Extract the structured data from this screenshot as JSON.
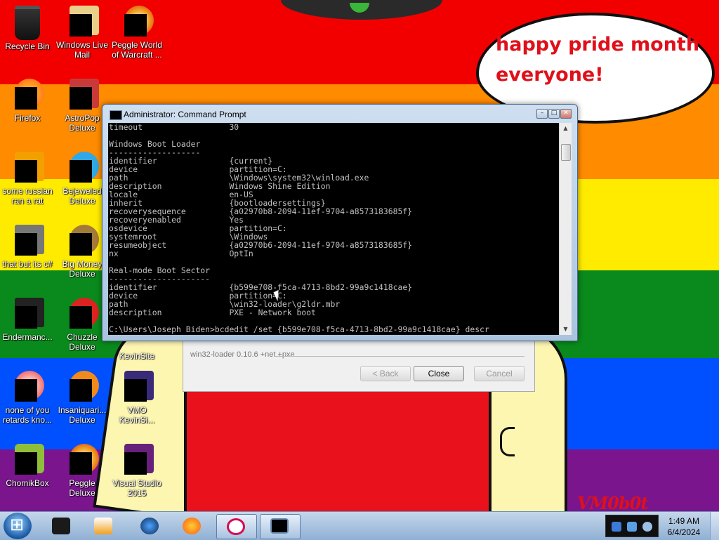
{
  "desktop": {
    "icons": [
      {
        "label": "Recycle Bin",
        "icon": "recycle-bin-icon"
      },
      {
        "label": "Windows Live Mail",
        "icon": "mail-icon"
      },
      {
        "label": "Peggle World of Warcraft ...",
        "icon": "peggle-icon"
      },
      {
        "label": "Firefox",
        "icon": "firefox-icon"
      },
      {
        "label": "AstroPop Deluxe",
        "icon": "astropop-icon"
      },
      {
        "label": "some russian ran a rat",
        "icon": "rat-icon"
      },
      {
        "label": "Bejeweled Deluxe",
        "icon": "bejeweled-icon"
      },
      {
        "label": "that but its c#",
        "icon": "app-icon"
      },
      {
        "label": "Big Money Deluxe",
        "icon": "bigmoney-icon"
      },
      {
        "label": "Endermanc...",
        "icon": "endermanch-icon"
      },
      {
        "label": "Chuzzle Deluxe",
        "icon": "chuzzle-icon"
      },
      {
        "label": "KevinSite",
        "icon": "website-icon"
      },
      {
        "label": "none of you retards kno...",
        "icon": "app-icon"
      },
      {
        "label": "Insaniquari... Deluxe",
        "icon": "insaniquarium-icon"
      },
      {
        "label": "VMO KevinSi...",
        "icon": "website-icon"
      },
      {
        "label": "ChomikBox",
        "icon": "chomikbox-icon"
      },
      {
        "label": "Peggle Deluxe",
        "icon": "peggle-icon"
      },
      {
        "label": "Visual Studio 2015",
        "icon": "visual-studio-icon"
      }
    ],
    "bubble_text_line1": "happy pride month",
    "bubble_text_line2": "everyone!",
    "watermark": "VM0b0t",
    "flag_colors": [
      "#f20000",
      "#ff8b00",
      "#ffeb00",
      "#0a8a1c",
      "#0050ff",
      "#7a158e"
    ]
  },
  "cmd_window": {
    "title": "Administrator: Command Prompt",
    "controls": {
      "minimize": "–",
      "maximize": "□",
      "close": "✕"
    },
    "lines": [
      "timeout                  30",
      "",
      "Windows Boot Loader",
      "-------------------",
      "identifier               {current}",
      "device                   partition=C:",
      "path                     \\Windows\\system32\\winload.exe",
      "description              Windows Shine Edition",
      "locale                   en-US",
      "inherit                  {bootloadersettings}",
      "recoverysequence         {a02970b8-2094-11ef-9704-a8573183685f}",
      "recoveryenabled          Yes",
      "osdevice                 partition=C:",
      "systemroot               \\Windows",
      "resumeobject             {a02970b6-2094-11ef-9704-a8573183685f}",
      "nx                       OptIn",
      "",
      "Real-mode Boot Sector",
      "---------------------",
      "identifier               {b599e708-f5ca-4713-8bd2-99a9c1418cae}",
      "device                   partition=C:",
      "path                     \\win32-loader\\g2ldr.mbr",
      "description              PXE - Network boot",
      "",
      "C:\\Users\\Joseph Biden>bcdedit /set {b599e708-f5ca-4713-8bd2-99a9c1418cae} descr"
    ]
  },
  "installer_dialog": {
    "caption": "win32-loader 0.10.6 +net +pxe",
    "back_label": "< Back",
    "close_label": "Close",
    "cancel_label": "Cancel"
  },
  "taskbar": {
    "buttons": [
      {
        "name": "file-manager-icon"
      },
      {
        "name": "media-player-icon"
      },
      {
        "name": "globe-icon"
      },
      {
        "name": "firefox-icon"
      },
      {
        "name": "debian-icon"
      },
      {
        "name": "command-prompt-icon"
      }
    ],
    "time": "1:49 AM",
    "date": "6/4/2024"
  }
}
